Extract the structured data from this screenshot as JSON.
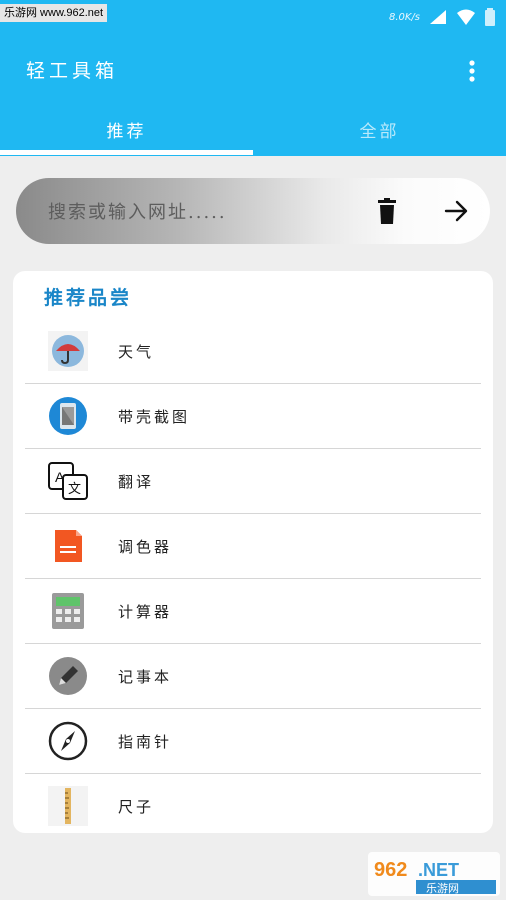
{
  "status_bar": {
    "watermark": "乐游网 www.962.net",
    "net_speed": "8.0K/s"
  },
  "app_bar": {
    "title": "轻工具箱",
    "background_color": "#1fb8f2"
  },
  "tabs": [
    {
      "label": "推荐",
      "active": true
    },
    {
      "label": "全部",
      "active": false
    }
  ],
  "search": {
    "placeholder": "搜索或输入网址....."
  },
  "card": {
    "title": "推荐品尝",
    "items": [
      {
        "label": "天气",
        "icon": "weather-umbrella-icon"
      },
      {
        "label": "带壳截图",
        "icon": "phone-screenshot-icon"
      },
      {
        "label": "翻译",
        "icon": "translate-icon"
      },
      {
        "label": "调色器",
        "icon": "palette-doc-icon"
      },
      {
        "label": "计算器",
        "icon": "calculator-icon"
      },
      {
        "label": "记事本",
        "icon": "pencil-icon"
      },
      {
        "label": "指南针",
        "icon": "compass-icon"
      },
      {
        "label": "尺子",
        "icon": "ruler-icon"
      }
    ]
  },
  "watermark_bottom": {
    "line1": "962.NET",
    "line2": "乐游网"
  }
}
